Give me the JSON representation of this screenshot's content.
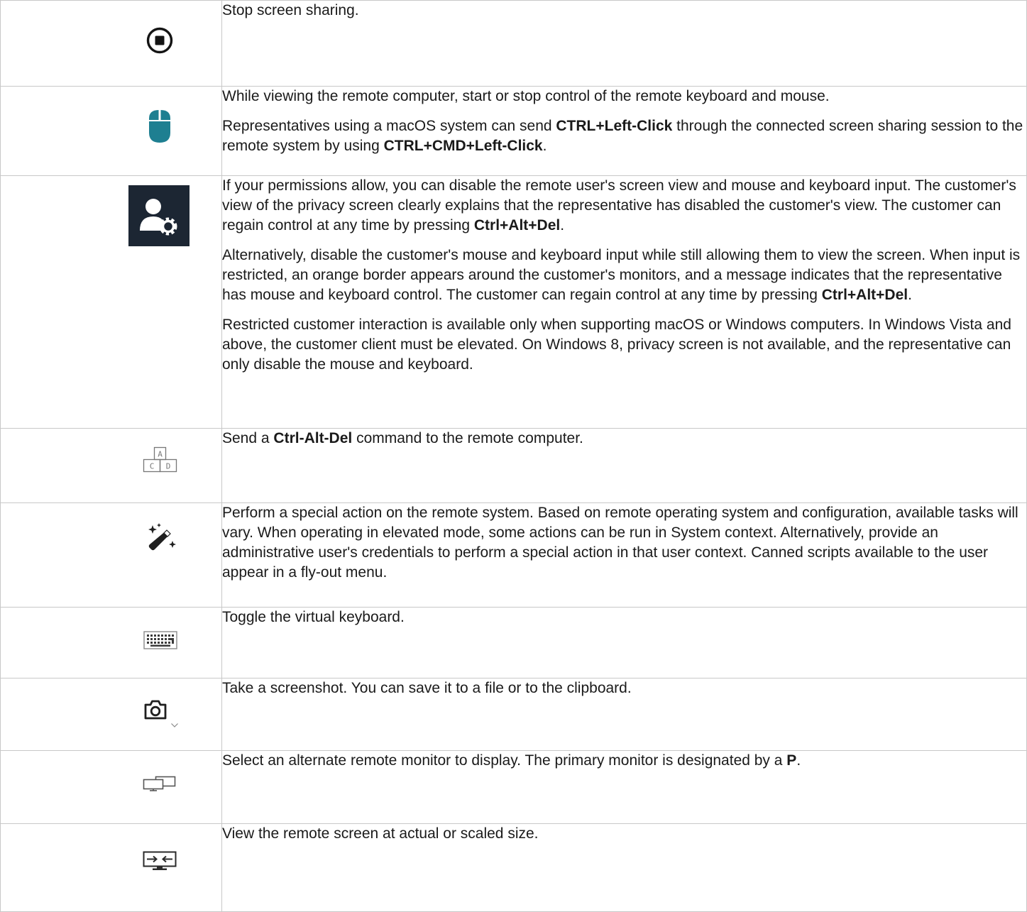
{
  "rows": [
    {
      "icon": "stop-circle-icon",
      "paragraphs": [
        {
          "parts": [
            {
              "t": "Stop screen sharing."
            }
          ]
        }
      ]
    },
    {
      "icon": "mouse-icon",
      "paragraphs": [
        {
          "parts": [
            {
              "t": "While viewing the remote computer, start or stop control of the remote keyboard and mouse."
            }
          ]
        },
        {
          "parts": [
            {
              "t": "Representatives using a macOS system can send "
            },
            {
              "t": "CTRL+Left-Click",
              "b": true
            },
            {
              "t": " through the connected screen sharing session to the remote system by using "
            },
            {
              "t": "CTRL+CMD+Left-Click",
              "b": true
            },
            {
              "t": "."
            }
          ]
        }
      ]
    },
    {
      "icon": "user-settings-icon",
      "paragraphs": [
        {
          "parts": [
            {
              "t": "If your permissions allow, you can disable the remote user's screen view and mouse and keyboard input. The customer's view of the privacy screen clearly explains that the representative has disabled the customer's view. The customer can regain control at any time by pressing "
            },
            {
              "t": "Ctrl+Alt+Del",
              "b": true
            },
            {
              "t": "."
            }
          ]
        },
        {
          "parts": [
            {
              "t": "Alternatively, disable the customer's mouse and keyboard input while still allowing them to view the screen. When input is restricted, an orange border appears around the customer's monitors, and a message indicates that the representative has mouse and keyboard control. The customer can regain control at any time by pressing "
            },
            {
              "t": "Ctrl+Alt+Del",
              "b": true
            },
            {
              "t": "."
            }
          ]
        },
        {
          "parts": [
            {
              "t": "Restricted customer interaction is available only when supporting macOS or Windows computers. In Windows Vista and above, the customer client must be elevated. On Windows 8, privacy screen is not available, and the representative can only disable the mouse and keyboard."
            }
          ]
        }
      ]
    },
    {
      "icon": "ctrl-alt-del-icon",
      "icon_keys": [
        "A",
        "C",
        "D"
      ],
      "paragraphs": [
        {
          "parts": [
            {
              "t": "Send a "
            },
            {
              "t": "Ctrl-Alt-Del",
              "b": true
            },
            {
              "t": " command to the remote computer."
            }
          ]
        }
      ]
    },
    {
      "icon": "magic-wand-icon",
      "paragraphs": [
        {
          "parts": [
            {
              "t": "Perform a special action on the remote system. Based on remote operating system and configuration, available tasks will vary. When operating in elevated mode, some actions can be run in System context. Alternatively, provide an administrative user's credentials to perform a special action in that user context. Canned scripts available to the user appear in a fly-out menu."
            }
          ]
        }
      ]
    },
    {
      "icon": "keyboard-icon",
      "paragraphs": [
        {
          "parts": [
            {
              "t": "Toggle the virtual keyboard."
            }
          ]
        }
      ]
    },
    {
      "icon": "camera-icon",
      "paragraphs": [
        {
          "parts": [
            {
              "t": "Take a screenshot. You can save it to a file or to the clipboard."
            }
          ]
        }
      ]
    },
    {
      "icon": "monitors-icon",
      "paragraphs": [
        {
          "parts": [
            {
              "t": "Select an alternate remote monitor to display. The primary monitor is designated by a "
            },
            {
              "t": "P",
              "b": true
            },
            {
              "t": "."
            }
          ]
        }
      ]
    },
    {
      "icon": "scale-screen-icon",
      "paragraphs": [
        {
          "parts": [
            {
              "t": "View the remote screen at actual or scaled size."
            }
          ]
        }
      ]
    }
  ]
}
